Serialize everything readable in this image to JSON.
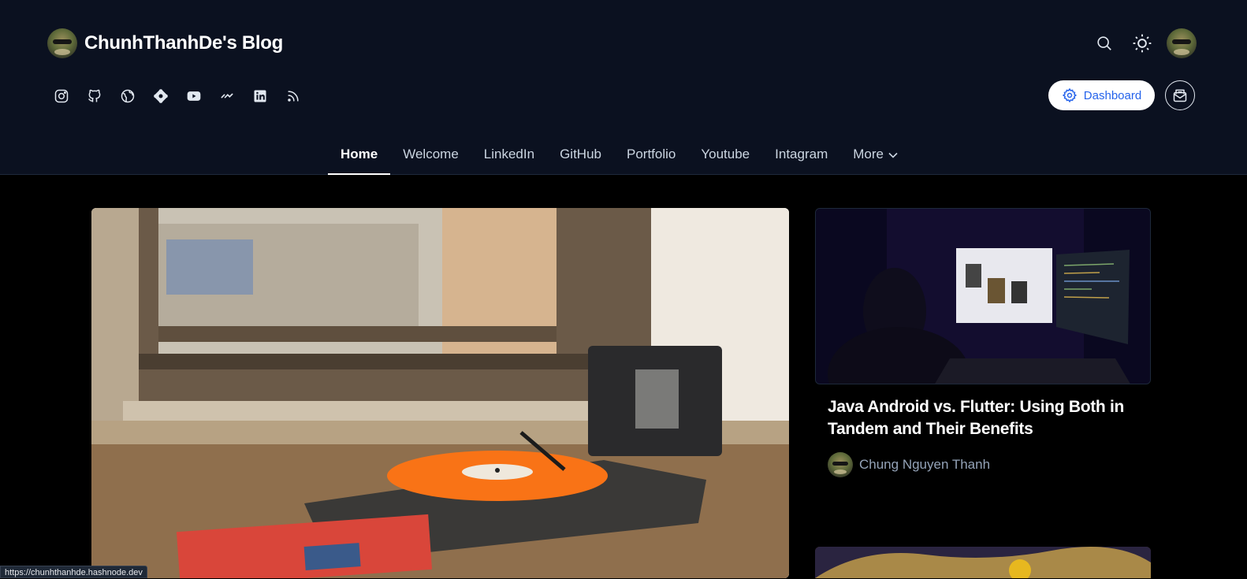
{
  "blog": {
    "title": "ChunhThanhDe's Blog"
  },
  "toolbar": {
    "search_icon": "search-icon",
    "theme_icon": "sun-icon",
    "dashboard_label": "Dashboard"
  },
  "socials": [
    "instagram",
    "github",
    "website",
    "hashnode",
    "youtube",
    "devto",
    "linkedin",
    "rss"
  ],
  "nav": {
    "items": [
      "Home",
      "Welcome",
      "LinkedIn",
      "GitHub",
      "Portfolio",
      "Youtube",
      "Intagram"
    ],
    "more_label": "More",
    "active": "Home"
  },
  "featured": {
    "title": "Java Android vs. Flutter: Using Both in Tandem and Their Benefits",
    "author": "Chung Nguyen Thanh"
  },
  "status_url": "https://chunhthanhde.hashnode.dev",
  "colors": {
    "header_bg": "#0b1120",
    "accent": "#2563eb",
    "record": "#f97316"
  }
}
